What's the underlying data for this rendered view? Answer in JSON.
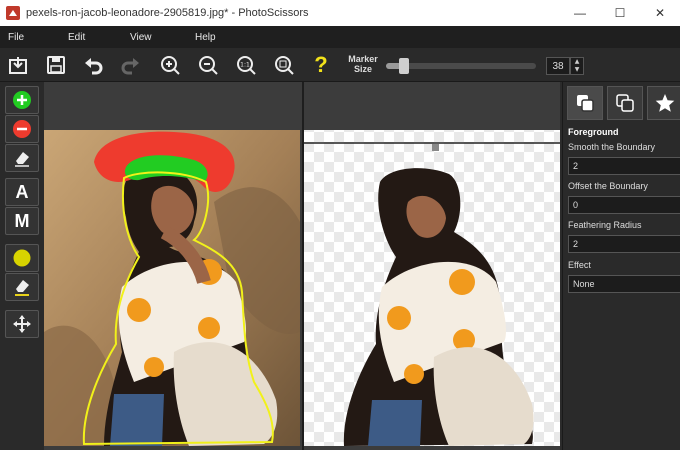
{
  "window": {
    "title": "pexels-ron-jacob-leonadore-2905819.jpg* - PhotoScissors",
    "minimize": "—",
    "maximize": "☐",
    "close": "✕"
  },
  "menu": {
    "items": [
      "File",
      "Edit",
      "View",
      "Help"
    ]
  },
  "toolbar": {
    "marker_label": "Marker Size",
    "marker_value": "38",
    "marker_level": 0.12,
    "help_icon": "?"
  },
  "left_tools": {
    "letter_a": "A",
    "letter_m": "M"
  },
  "panel": {
    "section": "Foreground",
    "smooth_label": "Smooth the Boundary",
    "smooth_value": "2",
    "offset_label": "Offset the Boundary",
    "offset_value": "0",
    "feather_label": "Feathering Radius",
    "feather_value": "2",
    "effect_label": "Effect",
    "effect_value": "None"
  },
  "colors": {
    "foreground_marker": "#22cc22",
    "background_marker": "#ee3b2e",
    "boundary": "#f1f11a",
    "accent_yellow": "#f2e21a"
  }
}
